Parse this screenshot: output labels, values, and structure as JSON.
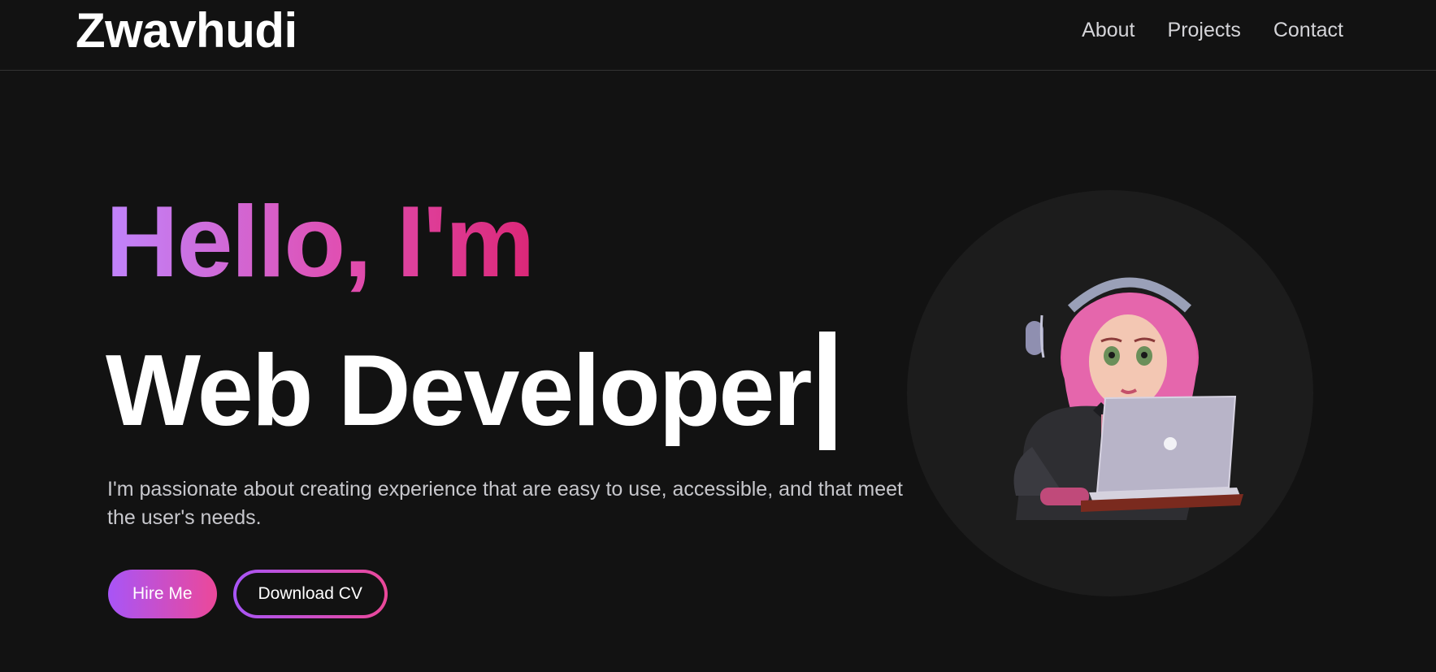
{
  "header": {
    "brand": "Zwavhudi",
    "nav": [
      "About",
      "Projects",
      "Contact"
    ]
  },
  "hero": {
    "greeting": "Hello, I'm",
    "role": "Web Developer",
    "description": "I'm passionate about creating experience that are easy to use, accessible, and that meet the user's needs.",
    "primary_button": "Hire Me",
    "secondary_button": "Download CV",
    "illustration_icon": "developer-avatar-illustration"
  },
  "colors": {
    "background": "#121212",
    "gradient_start": "#a855f7",
    "gradient_end": "#ec4899"
  }
}
